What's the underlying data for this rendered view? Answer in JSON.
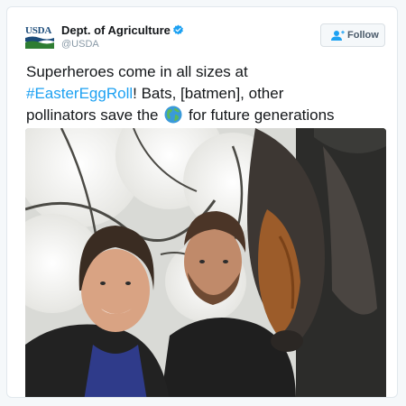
{
  "account": {
    "logo_text": "USDA",
    "display_name": "Dept. of Agriculture",
    "handle": "@USDA",
    "verified_icon": "verified-badge-icon"
  },
  "follow_button": {
    "label": "Follow",
    "icon": "add-user-icon"
  },
  "tweet": {
    "line1": "Superheroes come in all sizes at",
    "hashtag": "#EasterEggRoll",
    "line2_rest": "! Bats, [batmen], other",
    "line3_before_emoji": "pollinators save the",
    "emoji": "globe-icon",
    "line3_after_emoji": "for future generations"
  },
  "photo": {
    "description_icon": "selfie-with-bat-photo"
  },
  "colors": {
    "link": "#1da1f2",
    "verified": "#1da1f2",
    "usda_blue": "#1b4b7a",
    "usda_green": "#2e7d32"
  }
}
